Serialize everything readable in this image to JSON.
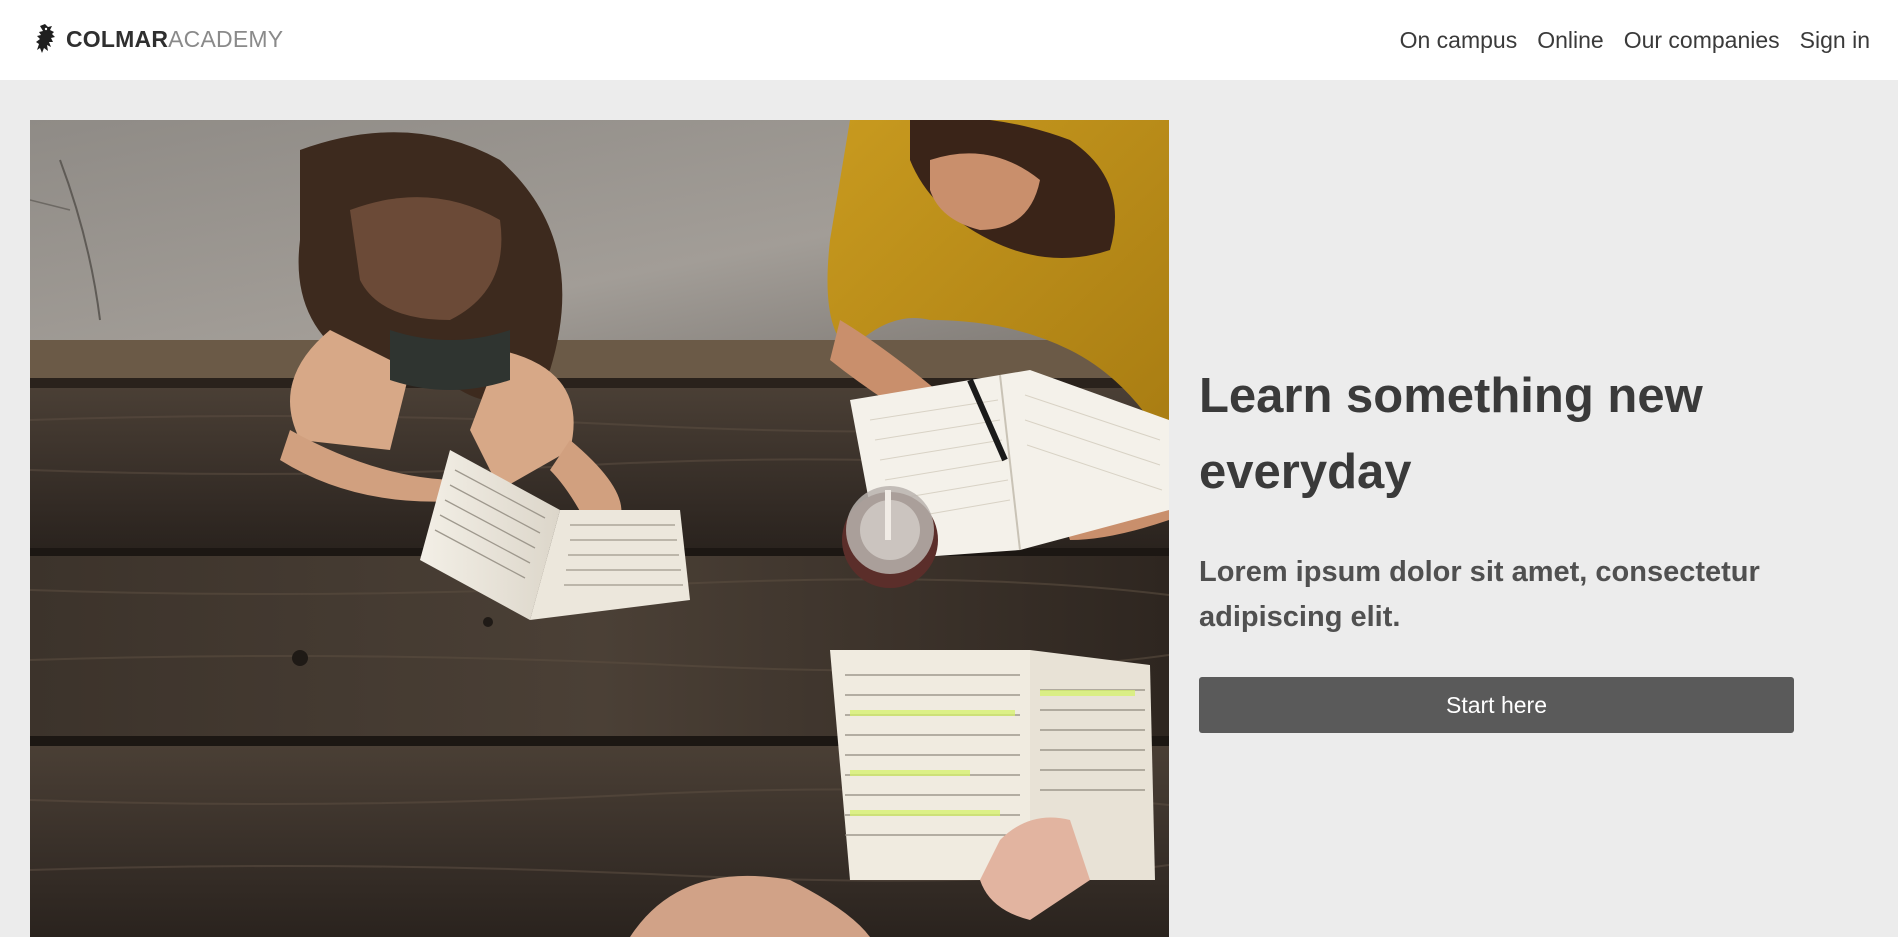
{
  "header": {
    "brand": {
      "strong": "COLMAR",
      "light": "ACADEMY",
      "icon": "griffin-logo-icon"
    },
    "nav": [
      {
        "label": "On campus"
      },
      {
        "label": "Online"
      },
      {
        "label": "Our companies"
      },
      {
        "label": "Sign in"
      }
    ]
  },
  "hero": {
    "photo": {
      "subject": "students-studying-at-picnic-table"
    },
    "title": "Learn something new everyday",
    "subtitle": "Lorem ipsum dolor sit amet, consectetur adipiscing elit.",
    "cta_label": "Start here"
  },
  "colors": {
    "page_background": "#ececec",
    "header_background": "#ffffff",
    "text": "#3a3a3a",
    "brand_light": "#8a8a8a",
    "button": "#5a5a5a",
    "button_text": "#ffffff"
  }
}
